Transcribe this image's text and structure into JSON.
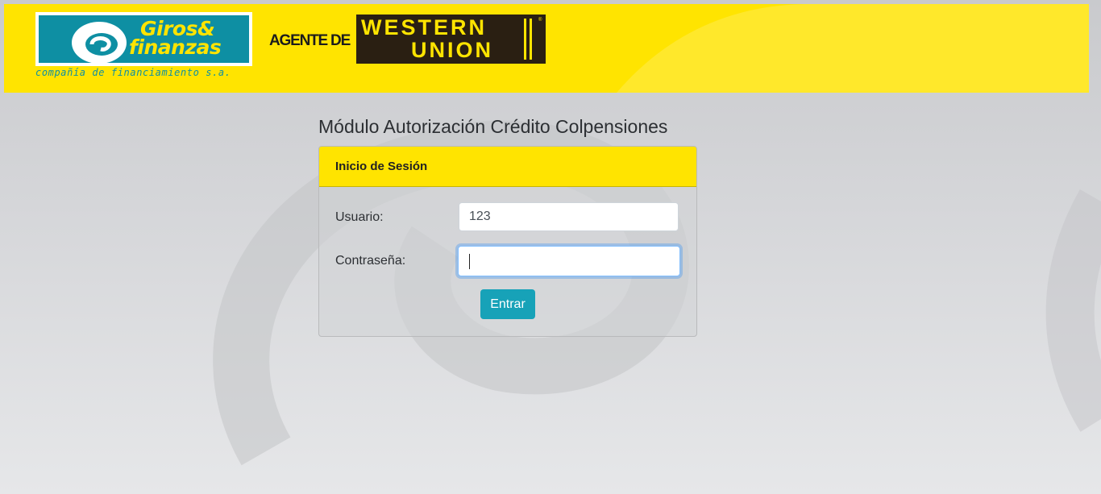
{
  "header": {
    "partner_logo": {
      "line1": "Giros&",
      "line2": "finanzas",
      "tagline": "compañía de financiamiento s.a."
    },
    "agent_text": "AGENTE DE",
    "western_union_logo": {
      "line1": "WESTERN",
      "line2": "UNION"
    }
  },
  "page": {
    "title": "Módulo Autorización Crédito Colpensiones"
  },
  "login": {
    "header": "Inicio de Sesión",
    "username_label": "Usuario:",
    "username_value": "123",
    "password_label": "Contraseña:",
    "password_value": "",
    "submit_label": "Entrar"
  },
  "colors": {
    "banner": "#ffe400",
    "logo_teal": "#0e8fa3",
    "western_union_dark": "#2a1f12",
    "button": "#17a2b8",
    "focus_ring": "#80bdff"
  }
}
